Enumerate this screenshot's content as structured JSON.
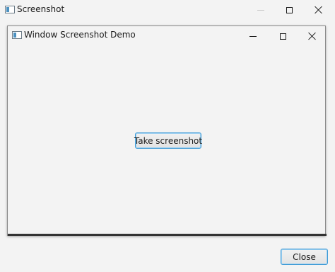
{
  "window": {
    "title": "Screenshot",
    "icon": "app-window-icon"
  },
  "inner_window": {
    "title": "Window Screenshot Demo",
    "icon": "app-window-icon",
    "take_screenshot_label": "Take screenshot"
  },
  "footer": {
    "close_label": "Close"
  },
  "colors": {
    "focus_border": "#3d9ad6",
    "background": "#f3f3f3"
  }
}
